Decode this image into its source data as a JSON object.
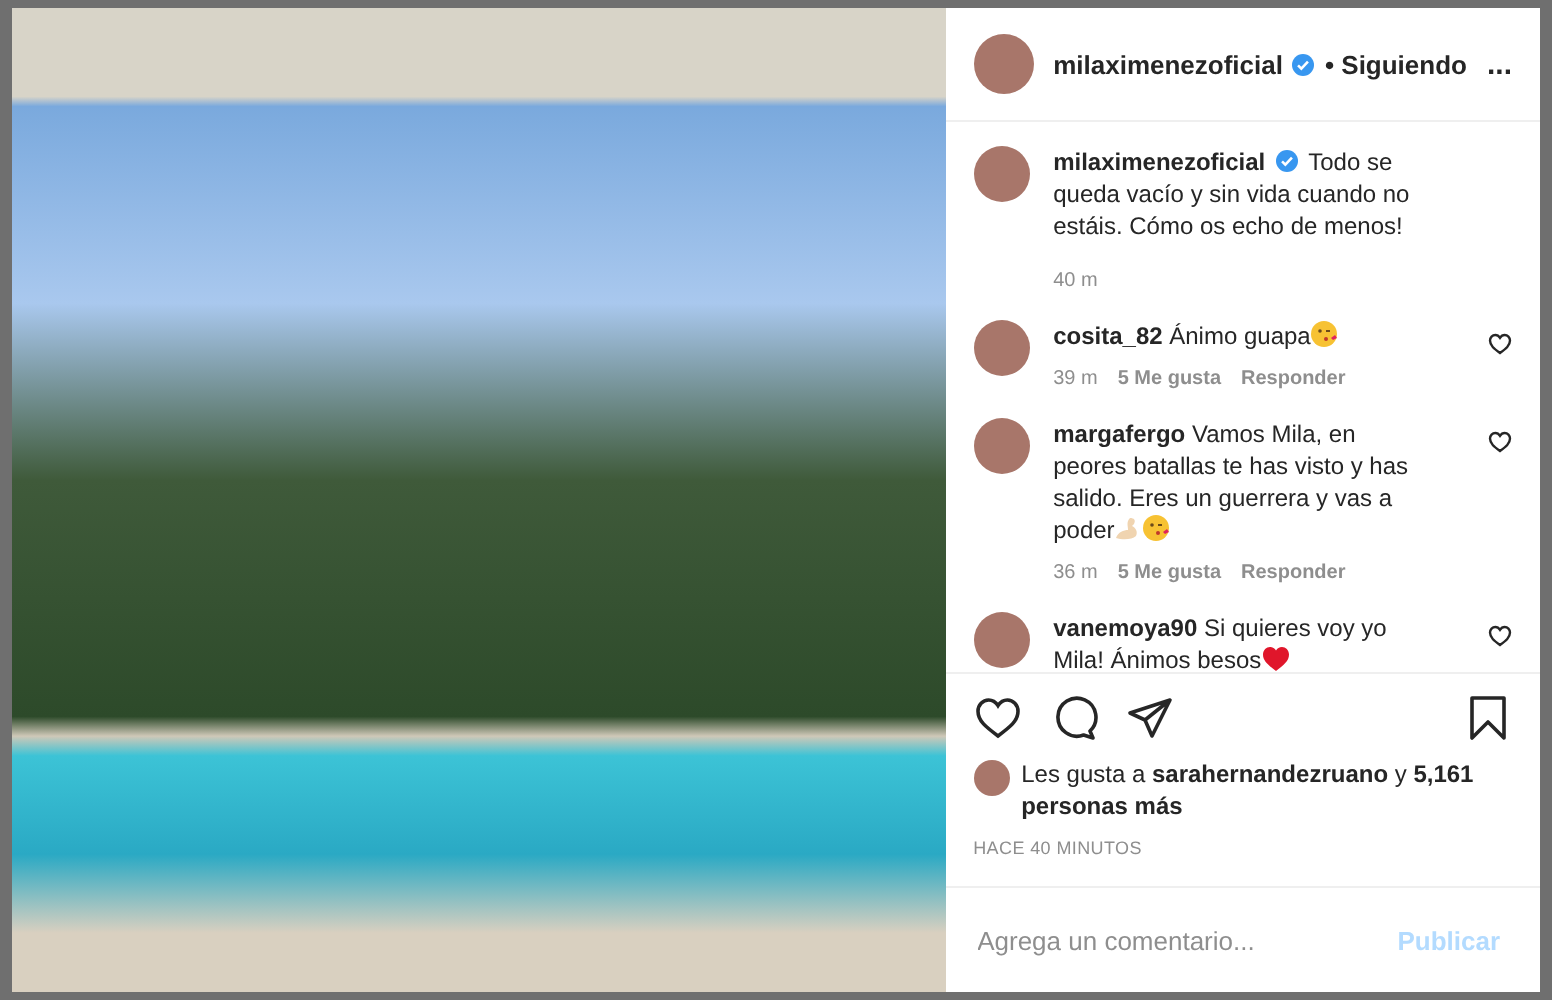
{
  "post": {
    "author": {
      "username": "milaximenezoficial",
      "verified": true,
      "follow_status": "• Siguiendo",
      "more": "..."
    },
    "caption": {
      "username": "milaximenezoficial",
      "verified": true,
      "text": "Todo se queda vacío y sin vida cuando no estáis. Cómo os echo de menos!",
      "time": "40 m"
    },
    "comments": [
      {
        "text": "**cosita_82** Ánimo guapa",
        "emoji": [
          {
            "kind": "kiss"
          }
        ],
        "time": "39 m",
        "likes": "5 Me gusta",
        "reply": "Responder",
        "liked": false
      },
      {
        "text": "**margafergo** Vamos Mila, en peores batallas te has visto y has salido. Eres un guerrera y vas a poder",
        "emoji": [
          {
            "kind": "muscle"
          },
          {
            "kind": "kiss"
          }
        ],
        "time": "36 m",
        "likes": "5 Me gusta",
        "reply": "Responder",
        "liked": false
      },
      {
        "text": "**vanemoya90** Si quieres voy yo Mila! Ánimos besos",
        "emoji": [
          {
            "kind": "heart"
          }
        ],
        "liked": false
      }
    ],
    "actions": {
      "liked": false,
      "saved": false
    },
    "likes_text": "Les gusta a **sarahernandezruano** y **5,161 personas más**",
    "timestamp": "HACE 40 MINUTOS",
    "comment_field": {
      "placeholder": "Agrega un comentario...",
      "submit": "Publicar"
    }
  }
}
